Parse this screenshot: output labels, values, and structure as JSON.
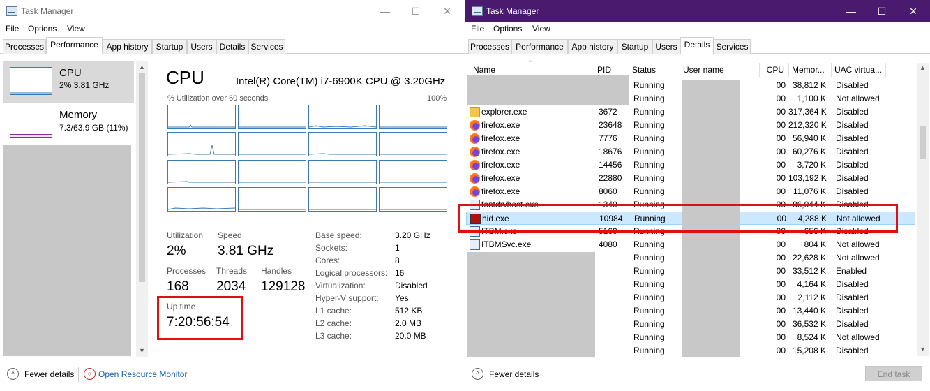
{
  "left_window": {
    "title": "Task Manager",
    "menu": [
      "File",
      "Options",
      "View"
    ],
    "tabs": [
      "Processes",
      "Performance",
      "App history",
      "Startup",
      "Users",
      "Details",
      "Services"
    ],
    "active_tab": "Performance",
    "sidebar": {
      "cpu": {
        "title": "CPU",
        "subtitle": "2% 3.81 GHz"
      },
      "memory": {
        "title": "Memory",
        "subtitle": "7.3/63.9 GB (11%)"
      }
    },
    "cpu_panel": {
      "title": "CPU",
      "model": "Intel(R) Core(TM) i7-6900K CPU @ 3.20GHz",
      "graph_caption": "% Utilization over 60 seconds",
      "graph_max": "100%",
      "stats": {
        "utilization_label": "Utilization",
        "utilization": "2%",
        "speed_label": "Speed",
        "speed": "3.81 GHz",
        "processes_label": "Processes",
        "processes": "168",
        "threads_label": "Threads",
        "threads": "2034",
        "handles_label": "Handles",
        "handles": "129128",
        "uptime_label": "Up time",
        "uptime": "7:20:56:54"
      },
      "specs": [
        {
          "label": "Base speed:",
          "value": "3.20 GHz"
        },
        {
          "label": "Sockets:",
          "value": "1"
        },
        {
          "label": "Cores:",
          "value": "8"
        },
        {
          "label": "Logical processors:",
          "value": "16"
        },
        {
          "label": "Virtualization:",
          "value": "Disabled"
        },
        {
          "label": "Hyper-V support:",
          "value": "Yes"
        },
        {
          "label": "L1 cache:",
          "value": "512 KB"
        },
        {
          "label": "L2 cache:",
          "value": "2.0 MB"
        },
        {
          "label": "L3 cache:",
          "value": "20.0 MB"
        }
      ]
    },
    "footer": {
      "fewer_details": "Fewer details",
      "resource_monitor": "Open Resource Monitor"
    }
  },
  "right_window": {
    "title": "Task Manager",
    "menu": [
      "File",
      "Options",
      "View"
    ],
    "tabs": [
      "Processes",
      "Performance",
      "App history",
      "Startup",
      "Users",
      "Details",
      "Services"
    ],
    "active_tab": "Details",
    "columns": [
      "Name",
      "PID",
      "Status",
      "User name",
      "CPU",
      "Memor...",
      "UAC virtua..."
    ],
    "rows": [
      {
        "name": "",
        "icon": "",
        "pid": "",
        "status": "Running",
        "cpu": "00",
        "memory": "38,812 K",
        "uac": "Disabled"
      },
      {
        "name": "",
        "icon": "",
        "pid": "",
        "status": "Running",
        "cpu": "00",
        "memory": "1,100 K",
        "uac": "Not allowed"
      },
      {
        "name": "explorer.exe",
        "icon": "folder-icon",
        "pid": "3672",
        "status": "Running",
        "cpu": "00",
        "memory": "317,364 K",
        "uac": "Disabled"
      },
      {
        "name": "firefox.exe",
        "icon": "firefox-icon",
        "pid": "23648",
        "status": "Running",
        "cpu": "00",
        "memory": "212,320 K",
        "uac": "Disabled"
      },
      {
        "name": "firefox.exe",
        "icon": "firefox-icon",
        "pid": "7776",
        "status": "Running",
        "cpu": "00",
        "memory": "56,940 K",
        "uac": "Disabled"
      },
      {
        "name": "firefox.exe",
        "icon": "firefox-icon",
        "pid": "18676",
        "status": "Running",
        "cpu": "00",
        "memory": "60,276 K",
        "uac": "Disabled"
      },
      {
        "name": "firefox.exe",
        "icon": "firefox-icon",
        "pid": "14456",
        "status": "Running",
        "cpu": "00",
        "memory": "3,720 K",
        "uac": "Disabled"
      },
      {
        "name": "firefox.exe",
        "icon": "firefox-icon",
        "pid": "22880",
        "status": "Running",
        "cpu": "00",
        "memory": "103,192 K",
        "uac": "Disabled"
      },
      {
        "name": "firefox.exe",
        "icon": "firefox-icon",
        "pid": "8060",
        "status": "Running",
        "cpu": "00",
        "memory": "11,076 K",
        "uac": "Disabled"
      },
      {
        "name": "fontdrvhost.exe",
        "icon": "svc-icon",
        "pid": "1340",
        "status": "Running",
        "cpu": "00",
        "memory": "86,044 K",
        "uac": "Disabled"
      },
      {
        "name": "hid.exe",
        "icon": "hid-icon",
        "pid": "10984",
        "status": "Running",
        "cpu": "00",
        "memory": "4,288 K",
        "uac": "Not allowed",
        "selected": true
      },
      {
        "name": "ITBM.exe",
        "icon": "svc-icon",
        "pid": "5160",
        "status": "Running",
        "cpu": "00",
        "memory": "656 K",
        "uac": "Disabled"
      },
      {
        "name": "ITBMSvc.exe",
        "icon": "svc-icon",
        "pid": "4080",
        "status": "Running",
        "cpu": "00",
        "memory": "804 K",
        "uac": "Not allowed"
      },
      {
        "name": "",
        "icon": "",
        "pid": "",
        "status": "Running",
        "cpu": "00",
        "memory": "22,628 K",
        "uac": "Not allowed"
      },
      {
        "name": "",
        "icon": "",
        "pid": "",
        "status": "Running",
        "cpu": "00",
        "memory": "33,512 K",
        "uac": "Enabled"
      },
      {
        "name": "",
        "icon": "",
        "pid": "",
        "status": "Running",
        "cpu": "00",
        "memory": "4,164 K",
        "uac": "Disabled"
      },
      {
        "name": "",
        "icon": "",
        "pid": "",
        "status": "Running",
        "cpu": "00",
        "memory": "2,112 K",
        "uac": "Disabled"
      },
      {
        "name": "",
        "icon": "",
        "pid": "",
        "status": "Running",
        "cpu": "00",
        "memory": "13,440 K",
        "uac": "Disabled"
      },
      {
        "name": "",
        "icon": "",
        "pid": "",
        "status": "Running",
        "cpu": "00",
        "memory": "36,532 K",
        "uac": "Disabled"
      },
      {
        "name": "",
        "icon": "",
        "pid": "",
        "status": "Running",
        "cpu": "00",
        "memory": "8,524 K",
        "uac": "Not allowed"
      },
      {
        "name": "",
        "icon": "",
        "pid": "",
        "status": "Running",
        "cpu": "00",
        "memory": "15,208 K",
        "uac": "Disabled"
      }
    ],
    "footer": {
      "fewer_details": "Fewer details",
      "end_task": "End task"
    }
  },
  "colors": {
    "titlebar_active": "#4a1a6e",
    "highlight_box": "#e01010",
    "cpu_graph": "#3b7ab8",
    "memory_graph": "#8b2a9b",
    "selection": "#cce8ff"
  }
}
